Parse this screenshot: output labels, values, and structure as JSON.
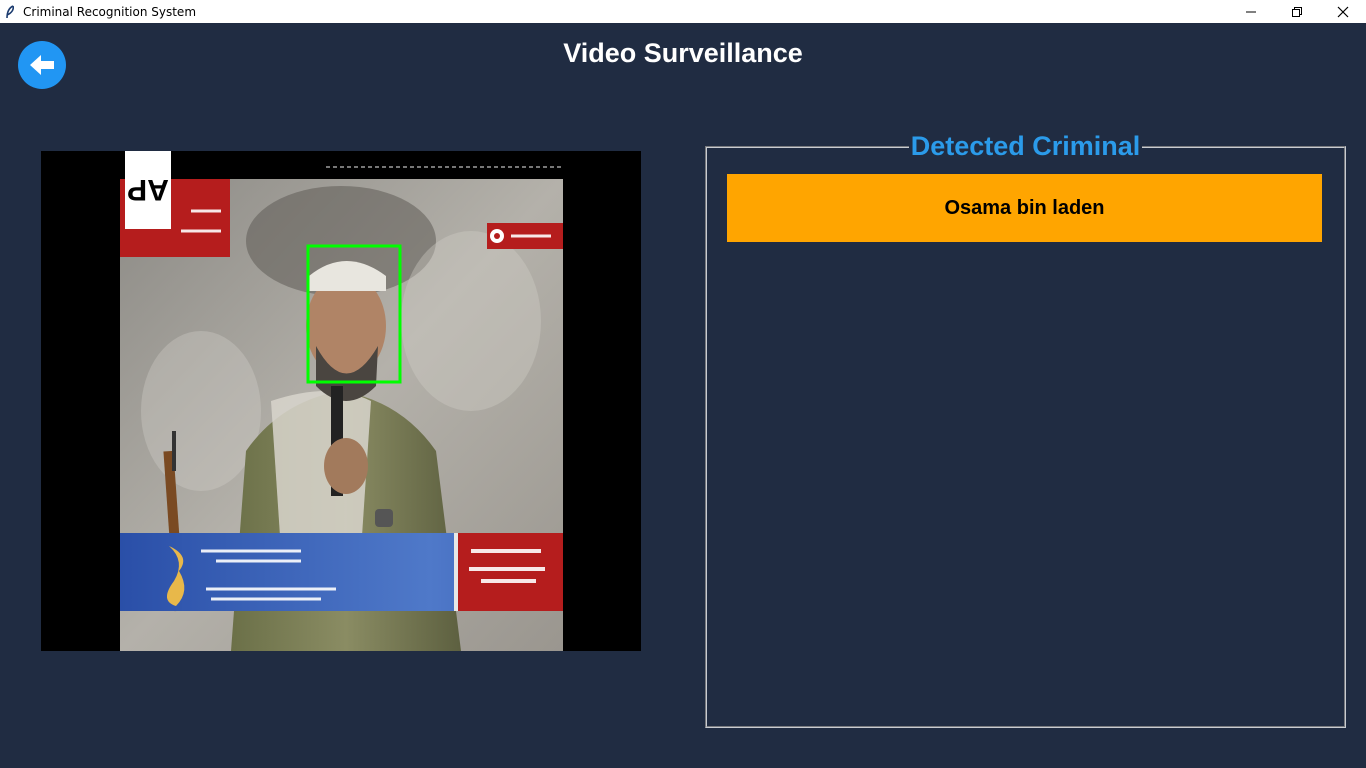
{
  "window": {
    "title": "Criminal Recognition System",
    "app_icon": "feather-icon",
    "controls": {
      "minimize_icon": "minimize-icon",
      "maximize_icon": "restore-icon",
      "close_icon": "close-icon"
    }
  },
  "header": {
    "back_icon": "arrow-left-icon",
    "title": "Video Surveillance"
  },
  "video": {
    "watermark": "AP",
    "face_box_color": "#00ff00",
    "logo": "Al Jazeera"
  },
  "detection": {
    "panel_title": "Detected Criminal",
    "criminals": [
      "Osama bin laden"
    ]
  },
  "colors": {
    "background": "#202c42",
    "accent": "#2196f3",
    "title_accent": "#2b9bea",
    "card": "#ffa500"
  }
}
